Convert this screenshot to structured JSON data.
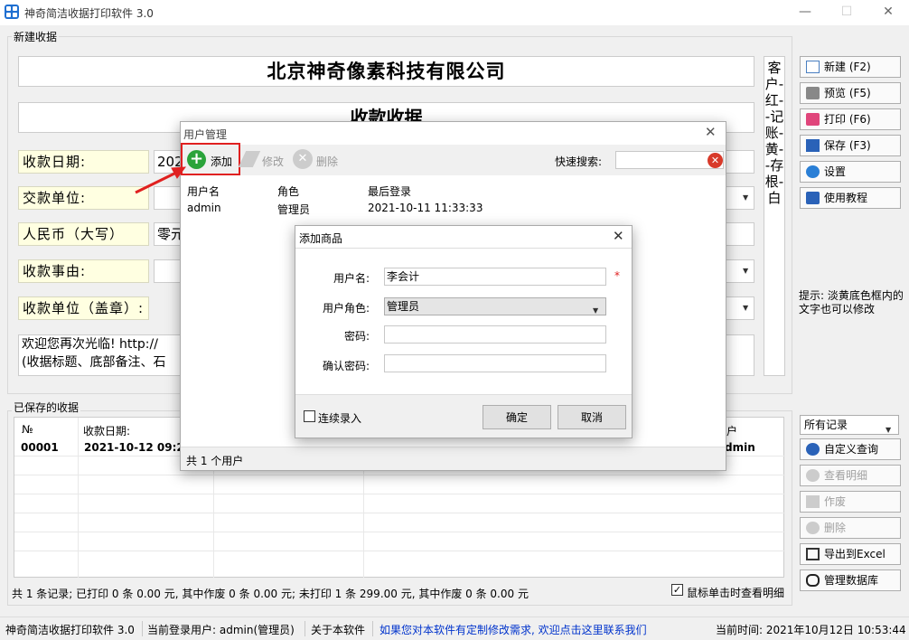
{
  "window": {
    "title": "神奇简洁收据打印软件 3.0"
  },
  "new_receipt": {
    "group_title": "新建收据",
    "company": "北京神奇像素科技有限公司",
    "receipt_title": "收款收据",
    "date_label": "收款日期:",
    "date_value": "202",
    "payer_label": "交款单位:",
    "rmb_label": "人民币（大写）",
    "rmb_value": "零元",
    "reason_label": "收款事由:",
    "stamp_label": "收款单位（盖章）:",
    "memo_line1": "欢迎您再次光临! http://",
    "memo_line2": "(收据标题、底部备注、石",
    "copies_text": "客户-红--记账-黄--存根-白",
    "hint": "提示: 淡黄底色框内的文字也可以修改"
  },
  "side_buttons": {
    "new": "新建 (F2)",
    "preview": "预览 (F5)",
    "print": "打印 (F6)",
    "save": "保存 (F3)",
    "settings": "设置",
    "tutorial": "使用教程"
  },
  "saved": {
    "group_title": "已保存的收据",
    "col_no": "№",
    "col_date": "收款日期:",
    "col_user_partial": "户",
    "row_no": "00001",
    "row_date": "2021-10-12 09:2",
    "row_user_partial": "dmin",
    "filter_value": "所有记录",
    "summary": "共 1 条记录; 已打印 0 条 0.00 元, 其中作废 0 条 0.00 元; 未打印 1 条 299.00 元, 其中作废 0 条 0.00 元",
    "click_view_label": "鼠标单击时查看明细",
    "click_view_checked": true
  },
  "saved_buttons": {
    "custom_query": "自定义查询",
    "view_detail": "查看明细",
    "void": "作废",
    "delete": "删除",
    "export": "导出到Excel",
    "manage_db": "管理数据库"
  },
  "user_dialog": {
    "title": "用户管理",
    "add": "添加",
    "edit": "修改",
    "delete": "删除",
    "search_label": "快速搜索:",
    "search_value": "",
    "columns": [
      "用户名",
      "角色",
      "最后登录"
    ],
    "rows": [
      [
        "admin",
        "管理员",
        "2021-10-11 11:33:33"
      ]
    ],
    "footer": "共 1 个用户"
  },
  "add_dialog": {
    "title": "添加商品",
    "username_label": "用户名:",
    "username_value": "李会计",
    "required_mark": "*",
    "role_label": "用户角色:",
    "role_value": "管理员",
    "password_label": "密码:",
    "password_value": "",
    "confirm_label": "确认密码:",
    "confirm_value": "",
    "continuous_label": "连续录入",
    "continuous_checked": false,
    "ok": "确定",
    "cancel": "取消"
  },
  "statusbar": {
    "app": "神奇简洁收据打印软件 3.0",
    "user": "当前登录用户: admin(管理员)",
    "about": "关于本软件",
    "link": "如果您对本软件有定制修改需求, 欢迎点击这里联系我们",
    "time": "当前时间: 2021年10月12日 10:53:44"
  },
  "colors": {
    "accent": "#1f6fd1",
    "annotation_red": "#e02020",
    "link": "#0033cc",
    "yellow_label": "#ffffe1"
  }
}
